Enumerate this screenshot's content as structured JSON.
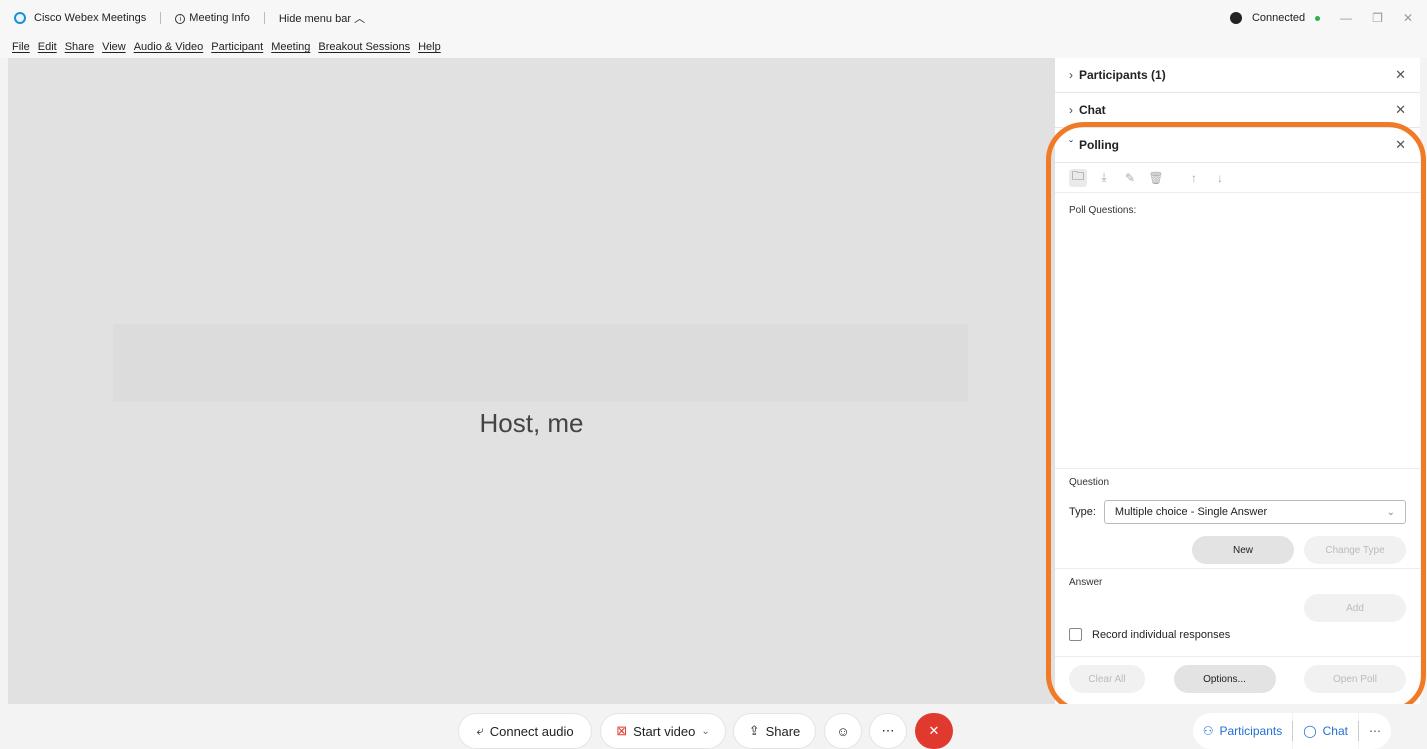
{
  "titlebar": {
    "app_name": "Cisco Webex Meetings",
    "meeting_info": "Meeting Info",
    "hide_menu": "Hide menu bar",
    "status": "Connected"
  },
  "menu": [
    "File",
    "Edit",
    "Share",
    "View",
    "Audio & Video",
    "Participant",
    "Meeting",
    "Breakout Sessions",
    "Help"
  ],
  "stage": {
    "host_label": "Host, me"
  },
  "panel": {
    "participants": "Participants (1)",
    "chat": "Chat",
    "polling": "Polling",
    "poll_questions": "Poll Questions:",
    "question_label": "Question",
    "type_label": "Type:",
    "type_value": "Multiple choice - Single Answer",
    "new_btn": "New",
    "change_type_btn": "Change Type",
    "answer_label": "Answer",
    "add_btn": "Add",
    "record_label": "Record individual responses",
    "clear_all_btn": "Clear All",
    "options_btn": "Options...",
    "open_poll_btn": "Open Poll"
  },
  "bottom": {
    "connect_audio": "Connect audio",
    "start_video": "Start video",
    "share": "Share",
    "participants": "Participants",
    "chat": "Chat"
  },
  "colors": {
    "highlight": "#f07a26",
    "end_call": "#e03a2f",
    "accent": "#1f6fd6"
  }
}
